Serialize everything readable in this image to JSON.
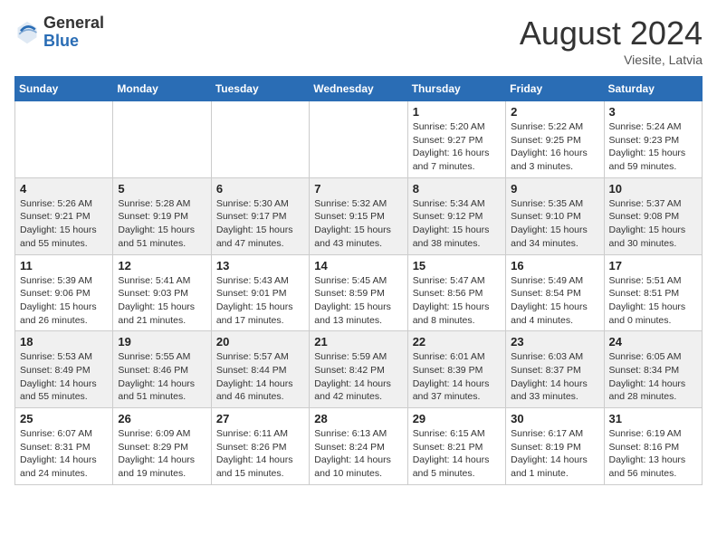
{
  "header": {
    "logo_general": "General",
    "logo_blue": "Blue",
    "month_year": "August 2024",
    "location": "Viesite, Latvia"
  },
  "days_of_week": [
    "Sunday",
    "Monday",
    "Tuesday",
    "Wednesday",
    "Thursday",
    "Friday",
    "Saturday"
  ],
  "weeks": [
    [
      {
        "day": "",
        "info": ""
      },
      {
        "day": "",
        "info": ""
      },
      {
        "day": "",
        "info": ""
      },
      {
        "day": "",
        "info": ""
      },
      {
        "day": "1",
        "info": "Sunrise: 5:20 AM\nSunset: 9:27 PM\nDaylight: 16 hours\nand 7 minutes."
      },
      {
        "day": "2",
        "info": "Sunrise: 5:22 AM\nSunset: 9:25 PM\nDaylight: 16 hours\nand 3 minutes."
      },
      {
        "day": "3",
        "info": "Sunrise: 5:24 AM\nSunset: 9:23 PM\nDaylight: 15 hours\nand 59 minutes."
      }
    ],
    [
      {
        "day": "4",
        "info": "Sunrise: 5:26 AM\nSunset: 9:21 PM\nDaylight: 15 hours\nand 55 minutes."
      },
      {
        "day": "5",
        "info": "Sunrise: 5:28 AM\nSunset: 9:19 PM\nDaylight: 15 hours\nand 51 minutes."
      },
      {
        "day": "6",
        "info": "Sunrise: 5:30 AM\nSunset: 9:17 PM\nDaylight: 15 hours\nand 47 minutes."
      },
      {
        "day": "7",
        "info": "Sunrise: 5:32 AM\nSunset: 9:15 PM\nDaylight: 15 hours\nand 43 minutes."
      },
      {
        "day": "8",
        "info": "Sunrise: 5:34 AM\nSunset: 9:12 PM\nDaylight: 15 hours\nand 38 minutes."
      },
      {
        "day": "9",
        "info": "Sunrise: 5:35 AM\nSunset: 9:10 PM\nDaylight: 15 hours\nand 34 minutes."
      },
      {
        "day": "10",
        "info": "Sunrise: 5:37 AM\nSunset: 9:08 PM\nDaylight: 15 hours\nand 30 minutes."
      }
    ],
    [
      {
        "day": "11",
        "info": "Sunrise: 5:39 AM\nSunset: 9:06 PM\nDaylight: 15 hours\nand 26 minutes."
      },
      {
        "day": "12",
        "info": "Sunrise: 5:41 AM\nSunset: 9:03 PM\nDaylight: 15 hours\nand 21 minutes."
      },
      {
        "day": "13",
        "info": "Sunrise: 5:43 AM\nSunset: 9:01 PM\nDaylight: 15 hours\nand 17 minutes."
      },
      {
        "day": "14",
        "info": "Sunrise: 5:45 AM\nSunset: 8:59 PM\nDaylight: 15 hours\nand 13 minutes."
      },
      {
        "day": "15",
        "info": "Sunrise: 5:47 AM\nSunset: 8:56 PM\nDaylight: 15 hours\nand 8 minutes."
      },
      {
        "day": "16",
        "info": "Sunrise: 5:49 AM\nSunset: 8:54 PM\nDaylight: 15 hours\nand 4 minutes."
      },
      {
        "day": "17",
        "info": "Sunrise: 5:51 AM\nSunset: 8:51 PM\nDaylight: 15 hours\nand 0 minutes."
      }
    ],
    [
      {
        "day": "18",
        "info": "Sunrise: 5:53 AM\nSunset: 8:49 PM\nDaylight: 14 hours\nand 55 minutes."
      },
      {
        "day": "19",
        "info": "Sunrise: 5:55 AM\nSunset: 8:46 PM\nDaylight: 14 hours\nand 51 minutes."
      },
      {
        "day": "20",
        "info": "Sunrise: 5:57 AM\nSunset: 8:44 PM\nDaylight: 14 hours\nand 46 minutes."
      },
      {
        "day": "21",
        "info": "Sunrise: 5:59 AM\nSunset: 8:42 PM\nDaylight: 14 hours\nand 42 minutes."
      },
      {
        "day": "22",
        "info": "Sunrise: 6:01 AM\nSunset: 8:39 PM\nDaylight: 14 hours\nand 37 minutes."
      },
      {
        "day": "23",
        "info": "Sunrise: 6:03 AM\nSunset: 8:37 PM\nDaylight: 14 hours\nand 33 minutes."
      },
      {
        "day": "24",
        "info": "Sunrise: 6:05 AM\nSunset: 8:34 PM\nDaylight: 14 hours\nand 28 minutes."
      }
    ],
    [
      {
        "day": "25",
        "info": "Sunrise: 6:07 AM\nSunset: 8:31 PM\nDaylight: 14 hours\nand 24 minutes."
      },
      {
        "day": "26",
        "info": "Sunrise: 6:09 AM\nSunset: 8:29 PM\nDaylight: 14 hours\nand 19 minutes."
      },
      {
        "day": "27",
        "info": "Sunrise: 6:11 AM\nSunset: 8:26 PM\nDaylight: 14 hours\nand 15 minutes."
      },
      {
        "day": "28",
        "info": "Sunrise: 6:13 AM\nSunset: 8:24 PM\nDaylight: 14 hours\nand 10 minutes."
      },
      {
        "day": "29",
        "info": "Sunrise: 6:15 AM\nSunset: 8:21 PM\nDaylight: 14 hours\nand 5 minutes."
      },
      {
        "day": "30",
        "info": "Sunrise: 6:17 AM\nSunset: 8:19 PM\nDaylight: 14 hours\nand 1 minute."
      },
      {
        "day": "31",
        "info": "Sunrise: 6:19 AM\nSunset: 8:16 PM\nDaylight: 13 hours\nand 56 minutes."
      }
    ]
  ]
}
